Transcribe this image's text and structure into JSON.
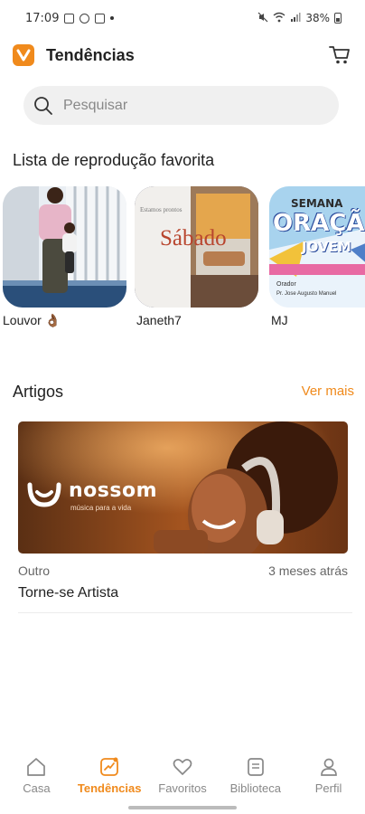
{
  "status_bar": {
    "time": "17:09",
    "battery": "38%"
  },
  "header": {
    "title": "Tendências"
  },
  "search": {
    "placeholder": "Pesquisar"
  },
  "playlists": {
    "title": "Lista de reprodução favorita",
    "items": [
      {
        "label": "Louvor 👌🏾"
      },
      {
        "label": "Janeth7",
        "image_text": "Sábado"
      },
      {
        "label": "MJ",
        "image_text_1": "SEMANA",
        "image_text_2": "ORAÇÃ",
        "image_text_3": "JOVEM"
      }
    ]
  },
  "articles": {
    "title": "Artigos",
    "see_more": "Ver mais",
    "items": [
      {
        "brand": "nossom",
        "tagline": "música para a vida",
        "category": "Outro",
        "time": "3 meses atrás",
        "title": "Torne-se Artista"
      }
    ]
  },
  "bottom_nav": {
    "items": [
      {
        "label": "Casa",
        "icon": "home-icon"
      },
      {
        "label": "Tendências",
        "icon": "trending-icon",
        "active": true
      },
      {
        "label": "Favoritos",
        "icon": "heart-icon"
      },
      {
        "label": "Biblioteca",
        "icon": "library-icon"
      },
      {
        "label": "Perfil",
        "icon": "profile-icon"
      }
    ]
  },
  "colors": {
    "accent": "#f08a1c",
    "text": "#222222",
    "muted": "#888888",
    "search_bg": "#f0f0f0"
  }
}
